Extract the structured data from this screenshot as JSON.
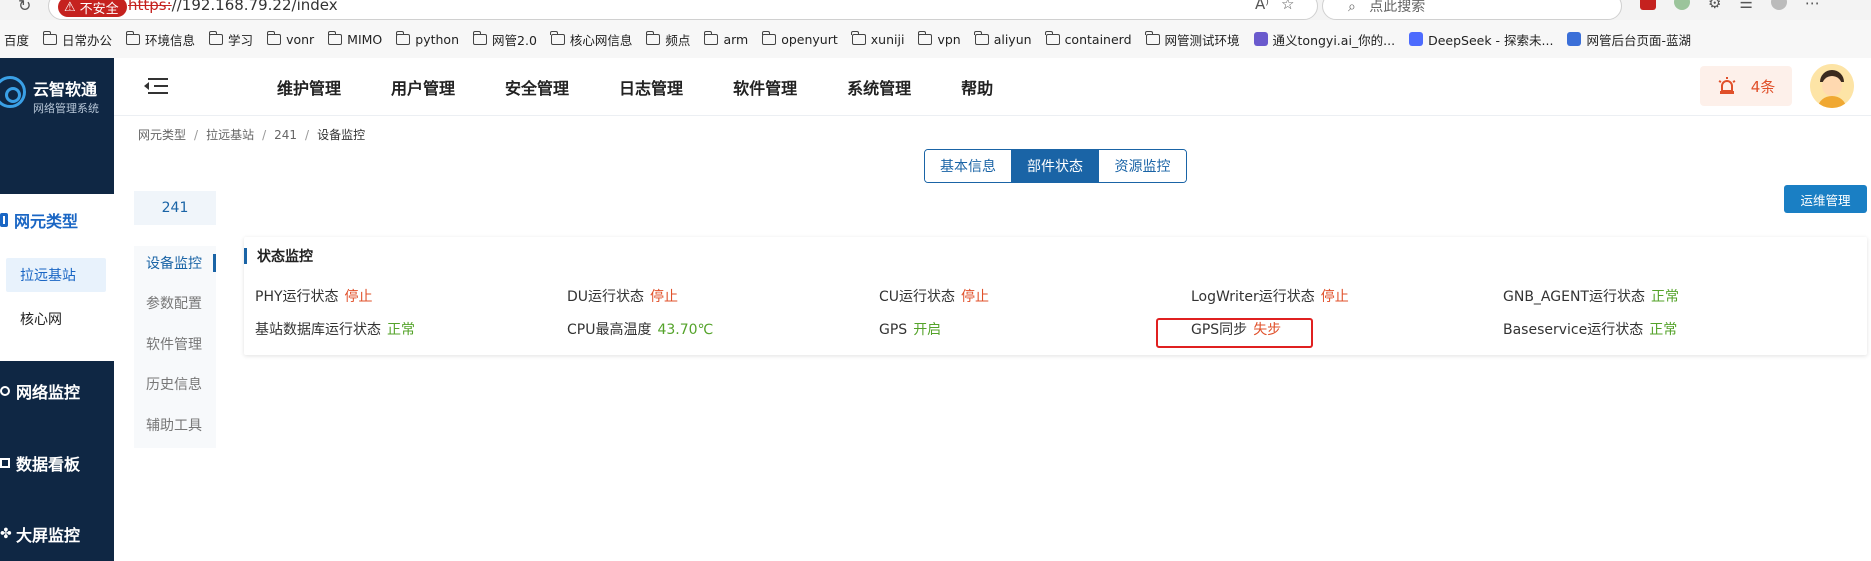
{
  "browser": {
    "insecure_label": "不安全",
    "url_scheme": "https:",
    "url_rest": "//192.168.79.22/index",
    "search_placeholder": "点此搜索"
  },
  "bookmarks": [
    {
      "label": "百度",
      "type": "text"
    },
    {
      "label": "日常办公",
      "type": "folder"
    },
    {
      "label": "环境信息",
      "type": "folder"
    },
    {
      "label": "学习",
      "type": "folder"
    },
    {
      "label": "vonr",
      "type": "folder"
    },
    {
      "label": "MIMO",
      "type": "folder"
    },
    {
      "label": "python",
      "type": "folder"
    },
    {
      "label": "网管2.0",
      "type": "folder"
    },
    {
      "label": "核心网信息",
      "type": "folder"
    },
    {
      "label": "频点",
      "type": "folder"
    },
    {
      "label": "arm",
      "type": "folder"
    },
    {
      "label": "openyurt",
      "type": "folder"
    },
    {
      "label": "xuniji",
      "type": "folder"
    },
    {
      "label": "vpn",
      "type": "folder"
    },
    {
      "label": "aliyun",
      "type": "folder"
    },
    {
      "label": "containerd",
      "type": "folder"
    },
    {
      "label": "网管测试环境",
      "type": "folder"
    },
    {
      "label": "通义tongyi.ai_你的...",
      "type": "site"
    },
    {
      "label": "DeepSeek - 探索未...",
      "type": "site"
    },
    {
      "label": "网管后台页面-蓝湖",
      "type": "site"
    }
  ],
  "logo": {
    "title": "云智软通",
    "subtitle": "网络管理系统"
  },
  "sidebar": {
    "menu": [
      {
        "label": "网元类型",
        "icon": "grid-icon",
        "active": true
      },
      {
        "label": "网络监控",
        "icon": "monitor-icon"
      },
      {
        "label": "数据看板",
        "icon": "chart-icon"
      },
      {
        "label": "大屏监控",
        "icon": "share-icon"
      }
    ],
    "submenu": [
      {
        "label": "拉远基站",
        "active": true
      },
      {
        "label": "核心网"
      }
    ]
  },
  "header": {
    "nav": [
      "维护管理",
      "用户管理",
      "安全管理",
      "日志管理",
      "软件管理",
      "系统管理",
      "帮助"
    ],
    "alarm_count": "4条"
  },
  "breadcrumb": [
    "网元类型",
    "拉远基站",
    "241",
    "设备监控"
  ],
  "tabs": [
    {
      "label": "基本信息"
    },
    {
      "label": "部件状态",
      "active": true
    },
    {
      "label": "资源监控"
    }
  ],
  "ops_button": "运维管理",
  "device_id": "241",
  "side_tabs": [
    {
      "label": "设备监控",
      "active": true
    },
    {
      "label": "参数配置"
    },
    {
      "label": "软件管理"
    },
    {
      "label": "历史信息"
    },
    {
      "label": "辅助工具"
    }
  ],
  "panel": {
    "title": "状态监控",
    "items": [
      {
        "label": "PHY运行状态",
        "value": "停止",
        "status": "bad"
      },
      {
        "label": "DU运行状态",
        "value": "停止",
        "status": "bad"
      },
      {
        "label": "CU运行状态",
        "value": "停止",
        "status": "bad"
      },
      {
        "label": "LogWriter运行状态",
        "value": "停止",
        "status": "bad"
      },
      {
        "label": "GNB_AGENT运行状态",
        "value": "正常",
        "status": "good"
      },
      {
        "label": "基站数据库运行状态",
        "value": "正常",
        "status": "good"
      },
      {
        "label": "CPU最高温度",
        "value": "43.70℃",
        "status": "good"
      },
      {
        "label": "GPS",
        "value": "开启",
        "status": "good"
      },
      {
        "label": "GPS同步",
        "value": "失步",
        "status": "bad"
      },
      {
        "label": "Baseservice运行状态",
        "value": "正常",
        "status": "good"
      }
    ]
  },
  "colors": {
    "sidebar_bg": "#0f2744",
    "primary": "#1a64a6",
    "danger": "#e0502a",
    "success": "#54a32a"
  }
}
